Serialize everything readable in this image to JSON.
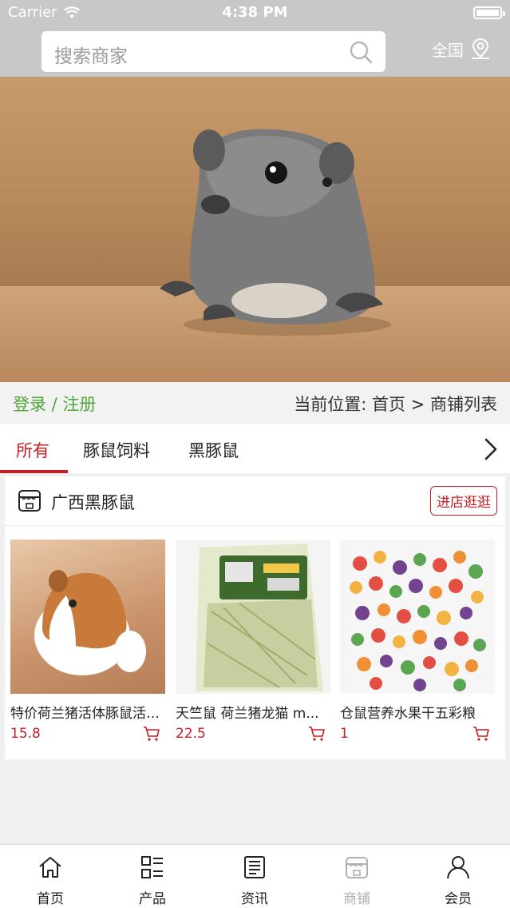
{
  "status": {
    "carrier": "Carrier",
    "time": "4:38 PM"
  },
  "header": {
    "search_placeholder": "搜索商家",
    "region": "全国"
  },
  "breadcrumb": {
    "login": "登录 / 注册",
    "location": "当前位置:  首页 > 商铺列表"
  },
  "tabs": [
    {
      "label": "所有"
    },
    {
      "label": "豚鼠饲料"
    },
    {
      "label": "黑豚鼠"
    }
  ],
  "shop": {
    "name": "广西黑豚鼠",
    "visit_label": "进店逛逛",
    "products": [
      {
        "name": "特价荷兰猪活体豚鼠活体天竺鼠",
        "price": "15.8"
      },
      {
        "name": "天竺鼠 荷兰猪龙猫 m...",
        "price": "22.5"
      },
      {
        "name": "仓鼠营养水果干五彩粮",
        "price": "1"
      }
    ]
  },
  "nav": [
    {
      "label": "首页",
      "icon": "home-icon"
    },
    {
      "label": "产品",
      "icon": "product-list-icon"
    },
    {
      "label": "资讯",
      "icon": "news-icon"
    },
    {
      "label": "商铺",
      "icon": "shop-icon"
    },
    {
      "label": "会员",
      "icon": "member-icon"
    }
  ],
  "colors": {
    "accent": "#c81d23",
    "login_green": "#4ea53a",
    "header_bg": "#c8c8c8"
  }
}
